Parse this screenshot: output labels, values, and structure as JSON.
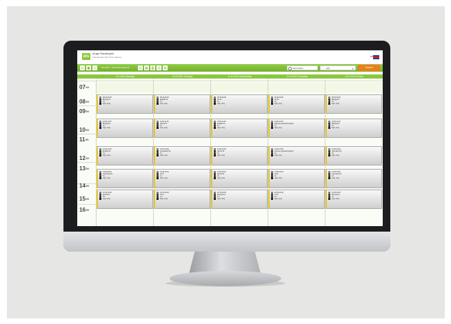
{
  "app": {
    "logo_text": "eis",
    "brand_line1": "all age Stundenplan",
    "brand_line2": "Stundenplan KW 24 für Klassen",
    "language": "EN",
    "accent_color": "#8cc63f",
    "button_color": "#f07c1b"
  },
  "toolbar": {
    "week_label": "9.6.2016 - 13.6.2016 Week 23",
    "search_value": "Scott Hebel",
    "select_value": "(all)",
    "search_button": "Search"
  },
  "days": [
    "9.6.2016 Monday",
    "10.6.2016 Tuesday",
    "11.6.2016 Wednesday",
    "12.6.2016 Thursday",
    "13.6.2016 Friday"
  ],
  "hours": [
    {
      "h": "07",
      "m": "00"
    },
    {
      "h": "08",
      "m": "00"
    },
    {
      "h": "09",
      "m": "00"
    },
    {
      "h": "10",
      "m": "00"
    },
    {
      "h": "11",
      "m": "00"
    },
    {
      "h": "12",
      "m": "00"
    },
    {
      "h": "13",
      "m": "00"
    },
    {
      "h": "14",
      "m": "00"
    },
    {
      "h": "15",
      "m": "00"
    },
    {
      "h": "16",
      "m": "00"
    }
  ],
  "event_rows": [
    {
      "time": "08:15-09:45",
      "subjects": [
        "Biology/7a",
        "English/7a",
        "Art/7a",
        "Art/7a",
        "Biology/7a"
      ]
    },
    {
      "time": "10:00-11:30",
      "subjects": [
        "Biology/7a",
        "Sports/7a",
        "English/7a",
        "Chinese (optional subject)",
        "Biology/7a"
      ]
    },
    {
      "time": "12:00-13:30",
      "subjects": [
        "English/7a",
        "Geography/7a",
        "Sports/7a",
        "Chinese (optional subject)",
        "Chemistry/7a"
      ]
    },
    {
      "time": "13:45-15:15",
      "subjects": [
        "Chemistry/7a",
        "IT/7a",
        "Sports/7a",
        "IT/7a",
        "Chemistry/7a"
      ]
    },
    {
      "time": "15:15-16:45",
      "subjects": [
        "Sports/7a",
        "IT/7a",
        "Physics/7a",
        "IT/7a",
        "Physics/7a"
      ]
    }
  ],
  "event_class": "7a",
  "event_room": "Gym, Gmj"
}
